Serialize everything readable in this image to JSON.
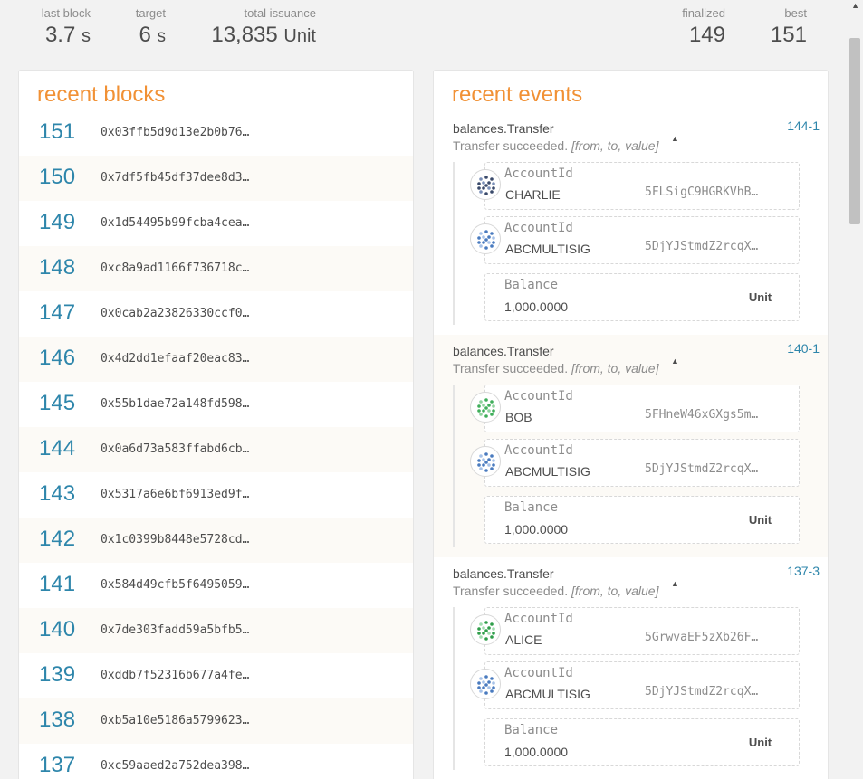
{
  "summary": {
    "last_block": {
      "label": "last block",
      "value": "3.7",
      "unit": "s"
    },
    "target": {
      "label": "target",
      "value": "6",
      "unit": "s"
    },
    "total_issuance": {
      "label": "total issuance",
      "value": "13,835",
      "unit": "Unit"
    },
    "finalized": {
      "label": "finalized",
      "value": "149"
    },
    "best": {
      "label": "best",
      "value": "151"
    }
  },
  "recent_blocks": {
    "title": "recent blocks",
    "items": [
      {
        "number": "151",
        "hash": "0x03ffb5d9d13e2b0b76…"
      },
      {
        "number": "150",
        "hash": "0x7df5fb45df37dee8d3…"
      },
      {
        "number": "149",
        "hash": "0x1d54495b99fcba4cea…"
      },
      {
        "number": "148",
        "hash": "0xc8a9ad1166f736718c…"
      },
      {
        "number": "147",
        "hash": "0x0cab2a23826330ccf0…"
      },
      {
        "number": "146",
        "hash": "0x4d2dd1efaaf20eac83…"
      },
      {
        "number": "145",
        "hash": "0x55b1dae72a148fd598…"
      },
      {
        "number": "144",
        "hash": "0x0a6d73a583ffabd6cb…"
      },
      {
        "number": "143",
        "hash": "0x5317a6e6bf6913ed9f…"
      },
      {
        "number": "142",
        "hash": "0x1c0399b8448e5728cd…"
      },
      {
        "number": "141",
        "hash": "0x584d49cfb5f6495059…"
      },
      {
        "number": "140",
        "hash": "0x7de303fadd59a5bfb5…"
      },
      {
        "number": "139",
        "hash": "0xddb7f52316b677a4fe…"
      },
      {
        "number": "138",
        "hash": "0xb5a10e5186a5799623…"
      },
      {
        "number": "137",
        "hash": "0xc59aaed2a752dea398…"
      }
    ]
  },
  "recent_events": {
    "title": "recent events",
    "items": [
      {
        "name": "balances.Transfer",
        "description": "Transfer succeeded.",
        "args": "[from, to, value]",
        "id": "144-1",
        "from": {
          "label": "AccountId",
          "name": "CHARLIE",
          "address": "5FLSigC9HGRKVhB…"
        },
        "to": {
          "label": "AccountId",
          "name": "ABCMULTISIG",
          "address": "5DjYJStmdZ2rcqX…"
        },
        "value": {
          "label": "Balance",
          "amount": "1,000.0000",
          "unit": "Unit"
        }
      },
      {
        "name": "balances.Transfer",
        "description": "Transfer succeeded.",
        "args": "[from, to, value]",
        "id": "140-1",
        "from": {
          "label": "AccountId",
          "name": "BOB",
          "address": "5FHneW46xGXgs5m…"
        },
        "to": {
          "label": "AccountId",
          "name": "ABCMULTISIG",
          "address": "5DjYJStmdZ2rcqX…"
        },
        "value": {
          "label": "Balance",
          "amount": "1,000.0000",
          "unit": "Unit"
        }
      },
      {
        "name": "balances.Transfer",
        "description": "Transfer succeeded.",
        "args": "[from, to, value]",
        "id": "137-3",
        "from": {
          "label": "AccountId",
          "name": "ALICE",
          "address": "5GrwvaEF5zXb26F…"
        },
        "to": {
          "label": "AccountId",
          "name": "ABCMULTISIG",
          "address": "5DjYJStmdZ2rcqX…"
        },
        "value": {
          "label": "Balance",
          "amount": "1,000.0000",
          "unit": "Unit"
        }
      }
    ]
  },
  "colors": {
    "accent_title": "#f19135",
    "link": "#2e86ab"
  },
  "icons": {
    "collapse": "caret-up-icon",
    "scroll_up": "scroll-up-arrow-icon"
  }
}
